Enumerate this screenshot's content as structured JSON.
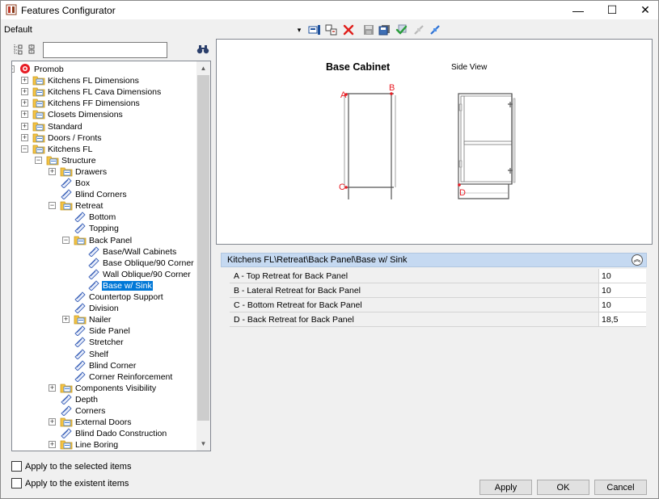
{
  "window": {
    "title": "Features Configurator",
    "minimize_glyph": "—",
    "maximize_glyph": "☐",
    "close_glyph": "✕"
  },
  "toolbar": {
    "profile": "Default",
    "dropdown_glyph": "▾"
  },
  "search": {
    "value": "",
    "placeholder": ""
  },
  "tree": {
    "items": [
      {
        "label": "Promob",
        "level": 0,
        "expander": "-",
        "icon": "promob-logo-icon"
      },
      {
        "label": "Kitchens FL Dimensions",
        "level": 1,
        "expander": "+",
        "icon": "folder-icon"
      },
      {
        "label": "Kitchens FL Cava Dimensions",
        "level": 1,
        "expander": "+",
        "icon": "folder-icon"
      },
      {
        "label": "Kitchens FF Dimensions",
        "level": 1,
        "expander": "+",
        "icon": "folder-icon"
      },
      {
        "label": "Closets Dimensions",
        "level": 1,
        "expander": "+",
        "icon": "folder-icon"
      },
      {
        "label": "Standard",
        "level": 1,
        "expander": "+",
        "icon": "folder-icon"
      },
      {
        "label": "Doors / Fronts",
        "level": 1,
        "expander": "+",
        "icon": "folder-icon"
      },
      {
        "label": "Kitchens FL",
        "level": 1,
        "expander": "-",
        "icon": "folder-icon"
      },
      {
        "label": "Structure",
        "level": 2,
        "expander": "-",
        "icon": "folder-icon"
      },
      {
        "label": "Drawers",
        "level": 3,
        "expander": "+",
        "icon": "folder-icon"
      },
      {
        "label": "Box",
        "level": 3,
        "expander": "",
        "icon": "feature-icon"
      },
      {
        "label": "Blind Corners",
        "level": 3,
        "expander": "",
        "icon": "feature-icon"
      },
      {
        "label": "Retreat",
        "level": 3,
        "expander": "-",
        "icon": "folder-icon"
      },
      {
        "label": "Bottom",
        "level": 4,
        "expander": "",
        "icon": "feature-icon"
      },
      {
        "label": "Topping",
        "level": 4,
        "expander": "",
        "icon": "feature-icon"
      },
      {
        "label": "Back Panel",
        "level": 4,
        "expander": "-",
        "icon": "folder-icon"
      },
      {
        "label": "Base/Wall Cabinets",
        "level": 5,
        "expander": "",
        "icon": "feature-icon"
      },
      {
        "label": "Base Oblique/90 Corner",
        "level": 5,
        "expander": "",
        "icon": "feature-icon"
      },
      {
        "label": "Wall Oblique/90 Corner",
        "level": 5,
        "expander": "",
        "icon": "feature-icon"
      },
      {
        "label": "Base w/ Sink",
        "level": 5,
        "expander": "",
        "icon": "feature-icon",
        "selected": true
      },
      {
        "label": "Countertop Support",
        "level": 4,
        "expander": "",
        "icon": "feature-icon"
      },
      {
        "label": "Division",
        "level": 4,
        "expander": "",
        "icon": "feature-icon"
      },
      {
        "label": "Nailer",
        "level": 4,
        "expander": "+",
        "icon": "folder-icon"
      },
      {
        "label": "Side Panel",
        "level": 4,
        "expander": "",
        "icon": "feature-icon"
      },
      {
        "label": "Stretcher",
        "level": 4,
        "expander": "",
        "icon": "feature-icon"
      },
      {
        "label": "Shelf",
        "level": 4,
        "expander": "",
        "icon": "feature-icon"
      },
      {
        "label": "Blind Corner",
        "level": 4,
        "expander": "",
        "icon": "feature-icon"
      },
      {
        "label": "Corner Reinforcement",
        "level": 4,
        "expander": "",
        "icon": "feature-icon"
      },
      {
        "label": "Components Visibility",
        "level": 3,
        "expander": "+",
        "icon": "folder-icon"
      },
      {
        "label": "Depth",
        "level": 3,
        "expander": "",
        "icon": "feature-icon"
      },
      {
        "label": "Corners",
        "level": 3,
        "expander": "",
        "icon": "feature-icon"
      },
      {
        "label": "External Doors",
        "level": 3,
        "expander": "+",
        "icon": "folder-icon"
      },
      {
        "label": "Blind Dado Construction",
        "level": 3,
        "expander": "",
        "icon": "feature-icon"
      },
      {
        "label": "Line Boring",
        "level": 3,
        "expander": "+",
        "icon": "folder-icon"
      }
    ]
  },
  "options": {
    "apply_selected": "Apply to the selected items",
    "apply_existent": "Apply to the existent items"
  },
  "preview": {
    "title_front": "Base Cabinet",
    "title_side": "Side View",
    "marker_a": "A",
    "marker_b": "B",
    "marker_c": "C",
    "marker_d": "D",
    "marker_color": "#e81c24"
  },
  "properties": {
    "path": "Kitchens FL\\Retreat\\Back Panel\\Base w/ Sink",
    "rows": [
      {
        "name": "A - Top Retreat for Back Panel",
        "value": "10"
      },
      {
        "name": "B - Lateral Retreat for Back Panel",
        "value": "10"
      },
      {
        "name": "C - Bottom Retreat for Back Panel",
        "value": "10"
      },
      {
        "name": "D - Back Retreat for Back Panel",
        "value": "18,5"
      }
    ]
  },
  "buttons": {
    "apply": "Apply",
    "ok": "OK",
    "cancel": "Cancel"
  },
  "colors": {
    "selection": "#0078d7",
    "header_bar": "#c5d9f1",
    "folder": "#f5c342"
  }
}
